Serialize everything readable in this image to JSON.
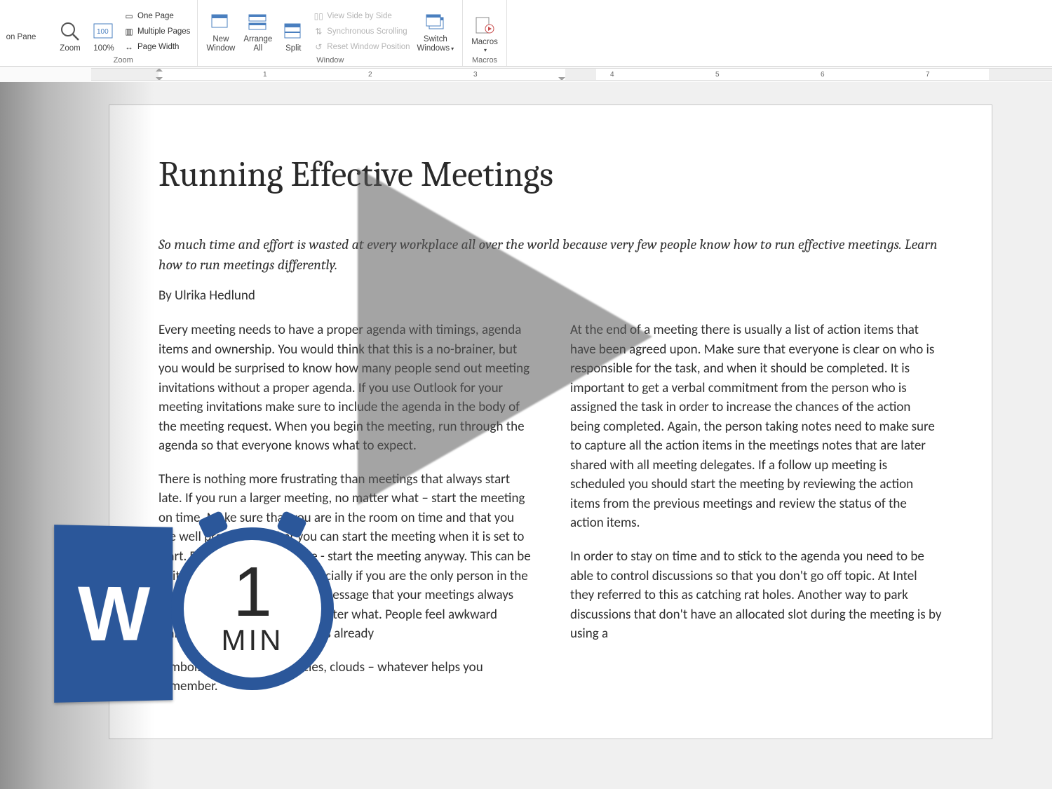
{
  "ribbon": {
    "nav_pane_fragment": "on Pane",
    "zoom_group": {
      "label": "Zoom",
      "zoom": "Zoom",
      "hundred": "100%",
      "one_page": "One Page",
      "multiple_pages": "Multiple Pages",
      "page_width": "Page Width"
    },
    "window_group": {
      "label": "Window",
      "new_window_1": "New",
      "new_window_2": "Window",
      "arrange_1": "Arrange",
      "arrange_2": "All",
      "split": "Split",
      "view_side": "View Side by Side",
      "sync_scroll": "Synchronous Scrolling",
      "reset_pos": "Reset Window Position",
      "switch_1": "Switch",
      "switch_2": "Windows"
    },
    "macros_group": {
      "label": "Macros",
      "macros": "Macros"
    }
  },
  "ruler": {
    "marks": [
      "1",
      "2",
      "3",
      "4",
      "5",
      "6",
      "7"
    ]
  },
  "document": {
    "title": "Running Effective Meetings",
    "intro": "So much time and effort is wasted at every workplace all over the world because very few people know how to run effective meetings. Learn how to run meetings differently.",
    "byline": "By Ulrika Hedlund",
    "para1": "Every meeting needs to have a proper agenda with timings, agenda items and ownership. You would think that this is a no-brainer, but you would be surprised to know how many people send out meeting invitations without a proper agenda. If you use Outlook for your meeting invitations make sure to include the agenda in the body of the meeting request. When you begin the meeting, run through the agenda so that everyone knows what to expect.",
    "para2": "There is nothing more frustrating than meetings that always start late. If you run a larger meeting, no matter what – start the meeting on time. Make sure that you are in the room on time and that you are well prepared so that you can start the meeting when it is set to start. Don't wait for everyone - start the meeting anyway. This can be quite difficult sometimes (especially if you are the only person in the room) but you need to send a message that your meetings always start (and finish) on time no matter what. People feel awkward walking in to a meeting that has already",
    "para3": "symbols; arrows, boxes, circles, clouds – whatever helps you remember.",
    "para4": "At the end of a meeting there is usually a list of action items that have been agreed upon. Make sure that everyone is clear on who is responsible for the task, and when it should be completed. It is important to get a verbal commitment from the person who is assigned the task in order to increase the chances of the action being completed. Again, the person taking notes need to make sure to capture all the action items in the meetings notes that are later shared with all meeting delegates. If a follow up meeting is scheduled you should start the meeting by reviewing the action items from the previous meetings and review the status of the action items.",
    "para5": "In order to stay on time and to stick to the agenda you need to be able to control discussions so that you don't go off topic. At Intel they referred to this as catching rat holes. Another way to park discussions that don't have an allocated slot during the meeting is by using a"
  },
  "overlay": {
    "word_letter": "W",
    "stopwatch_number": "1",
    "stopwatch_unit": "MIN"
  }
}
